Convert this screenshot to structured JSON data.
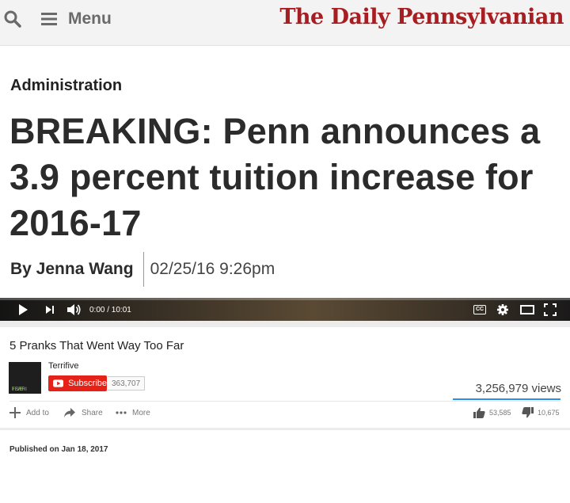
{
  "header": {
    "menu_label": "Menu",
    "masthead": "The Daily Pennsylvanian",
    "icons": [
      "search-icon",
      "hamburger-icon"
    ]
  },
  "article": {
    "category": "Administration",
    "headline": "BREAKING: Penn announces a 3.9 percent tuition increase for 2016-17",
    "author": "By Jenna Wang",
    "datetime": "02/25/16 9:26pm"
  },
  "video_player": {
    "time": "0:00 / 10:01",
    "progress": 0,
    "cc_label": "CC",
    "icons": [
      "play-icon",
      "next-icon",
      "volume-icon",
      "cc-icon",
      "settings-icon",
      "theater-icon",
      "fullscreen-icon"
    ]
  },
  "video_info": {
    "title": "5 Pranks That Went Way Too Far",
    "channel": {
      "name": "Terrifive",
      "logo_text_a": "TERRI",
      "logo_text_b": "FIVE"
    },
    "subscribe_label": "Subscribe",
    "subscriber_count": "363,707",
    "views": "3,256,979 views",
    "actions": {
      "add_to": "Add to",
      "share": "Share",
      "more": "More"
    },
    "likes": "53,585",
    "dislikes": "10,675",
    "published": "Published on Jan 18, 2017"
  },
  "colors": {
    "masthead_red": "#a71e22",
    "subscribe_red": "#e62117",
    "views_bar_blue": "#2793e6"
  }
}
